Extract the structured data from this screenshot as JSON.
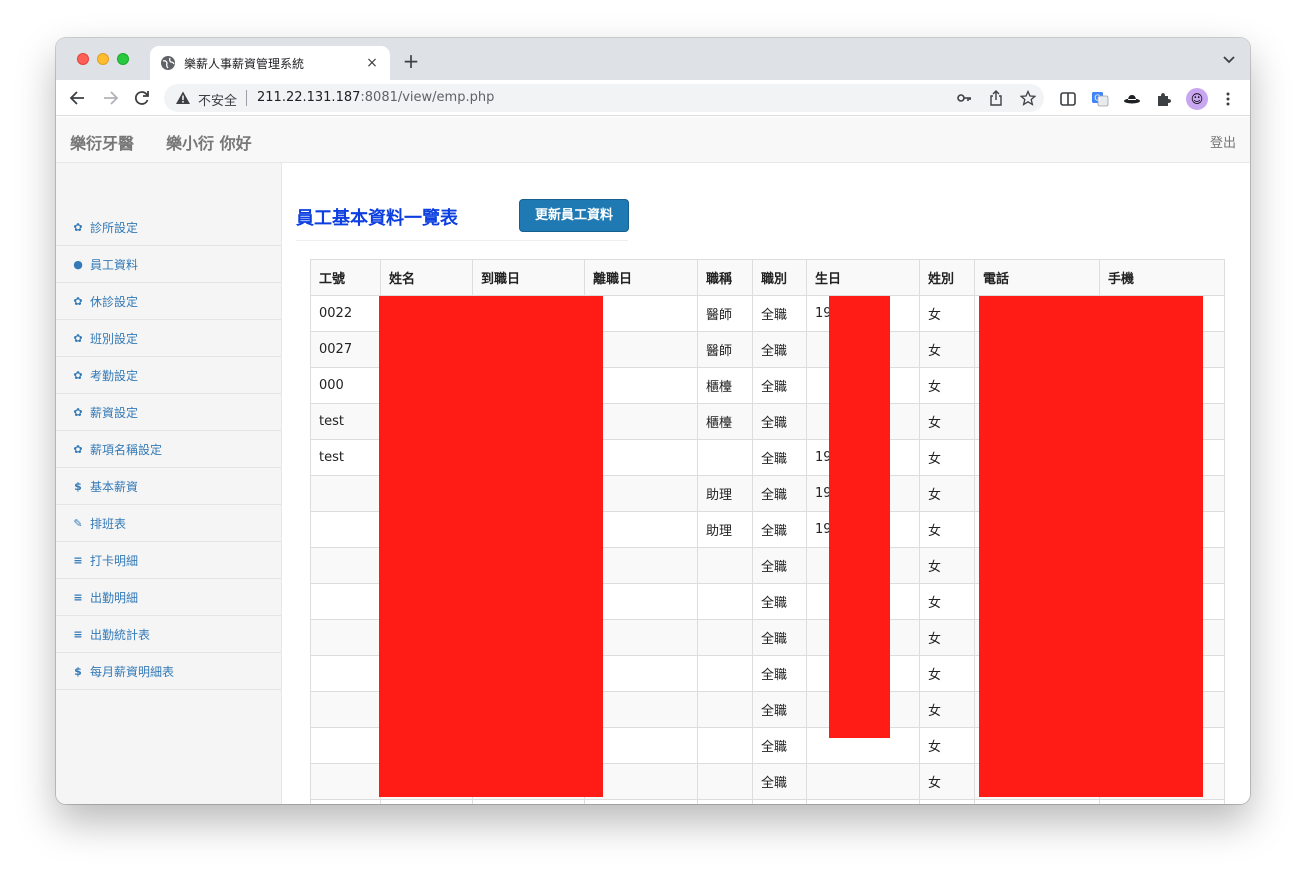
{
  "browser": {
    "tab_title": "樂薪人事薪資管理系統",
    "tab_close": "×",
    "new_tab": "+",
    "insecure_label": "不安全",
    "url_host": "211.22.131.187",
    "url_rest": ":8081/view/emp.php",
    "icons": [
      "back-icon",
      "forward-icon",
      "reload-icon",
      "warning-icon",
      "key-icon",
      "share-icon",
      "star-icon",
      "split-view-icon",
      "translate-icon",
      "hat-extension-icon",
      "puzzle-extensions-icon",
      "profile-avatar",
      "kebab-menu-icon"
    ]
  },
  "navbar": {
    "brand": "樂衍牙醫",
    "greeting": "樂小衍 你好",
    "logout": "登出"
  },
  "sidebar": {
    "items": [
      {
        "icon": "gear-icon",
        "glyph": "✿",
        "label": "診所設定"
      },
      {
        "icon": "user-icon",
        "glyph": "●",
        "label": "員工資料"
      },
      {
        "icon": "gear-icon",
        "glyph": "✿",
        "label": "休診設定"
      },
      {
        "icon": "gear-icon",
        "glyph": "✿",
        "label": "班別設定"
      },
      {
        "icon": "gear-icon",
        "glyph": "✿",
        "label": "考勤設定"
      },
      {
        "icon": "gear-icon",
        "glyph": "✿",
        "label": "薪資設定"
      },
      {
        "icon": "gear-icon",
        "glyph": "✿",
        "label": "薪項名稱設定"
      },
      {
        "icon": "dollar-icon",
        "glyph": "$",
        "label": "基本薪資"
      },
      {
        "icon": "edit-icon",
        "glyph": "✎",
        "label": "排班表"
      },
      {
        "icon": "list-icon",
        "glyph": "≡",
        "label": "打卡明細"
      },
      {
        "icon": "list-icon",
        "glyph": "≡",
        "label": "出勤明細"
      },
      {
        "icon": "list-icon",
        "glyph": "≡",
        "label": "出勤統計表"
      },
      {
        "icon": "dollar-icon",
        "glyph": "$",
        "label": "每月薪資明細表"
      }
    ]
  },
  "main": {
    "title": "員工基本資料一覽表",
    "update_button": "更新員工資料",
    "table": {
      "headers": [
        "工號",
        "姓名",
        "到職日",
        "離職日",
        "職稱",
        "職別",
        "生日",
        "姓別",
        "電話",
        "手機"
      ],
      "rows": [
        [
          "0022",
          "",
          "",
          "",
          "醫師",
          "全職",
          "19",
          "女",
          "",
          ""
        ],
        [
          "0027",
          "",
          "",
          "",
          "醫師",
          "全職",
          "",
          "女",
          "",
          ""
        ],
        [
          "000",
          "",
          "",
          "",
          "櫃檯",
          "全職",
          "",
          "女",
          "",
          ""
        ],
        [
          "test",
          "",
          "",
          "",
          "櫃檯",
          "全職",
          "",
          "女",
          "",
          ""
        ],
        [
          "test",
          "",
          "",
          "",
          "",
          "全職",
          "19",
          "女",
          "",
          ""
        ],
        [
          "",
          "",
          "",
          "",
          "助理",
          "全職",
          "19",
          "女",
          "",
          ""
        ],
        [
          "",
          "",
          "",
          "",
          "助理",
          "全職",
          "19",
          "女",
          "",
          ""
        ],
        [
          "",
          "",
          "",
          "",
          "",
          "全職",
          "",
          "女",
          "",
          ""
        ],
        [
          "",
          "",
          "",
          "",
          "",
          "全職",
          "",
          "女",
          "",
          ""
        ],
        [
          "",
          "",
          "",
          "",
          "",
          "全職",
          "",
          "女",
          "",
          ""
        ],
        [
          "",
          "",
          "",
          "",
          "",
          "全職",
          "",
          "女",
          "",
          ""
        ],
        [
          "",
          "",
          "",
          "",
          "",
          "全職",
          "",
          "女",
          "",
          ""
        ],
        [
          "",
          "",
          "",
          "",
          "",
          "全職",
          "",
          "女",
          "",
          ""
        ],
        [
          "",
          "",
          "",
          "",
          "",
          "全職",
          "",
          "女",
          "",
          ""
        ],
        [
          "",
          "",
          "",
          "",
          "",
          "",
          "",
          "",
          "",
          ""
        ]
      ]
    }
  },
  "colors": {
    "title": "#0d3fe0",
    "button": "#1f7ab3",
    "link": "#337ab7",
    "redaction": "#ff1c16"
  }
}
